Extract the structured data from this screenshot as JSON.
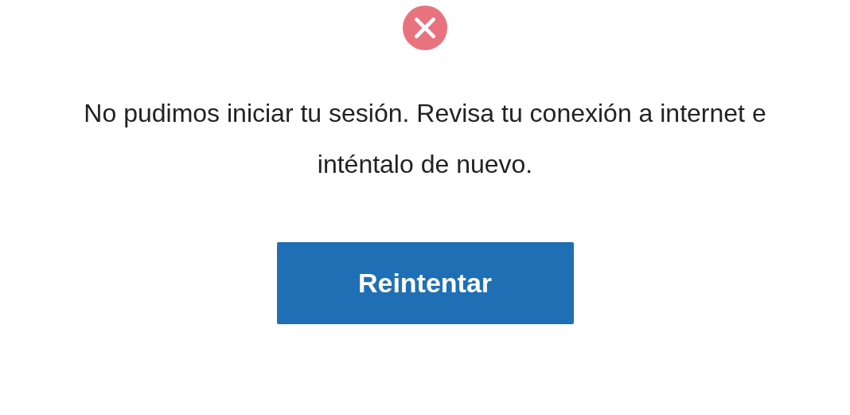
{
  "message": "No pudimos iniciar tu sesión. Revisa tu conexión a internet e inténtalo de nuevo.",
  "button": {
    "label": "Reintentar"
  }
}
